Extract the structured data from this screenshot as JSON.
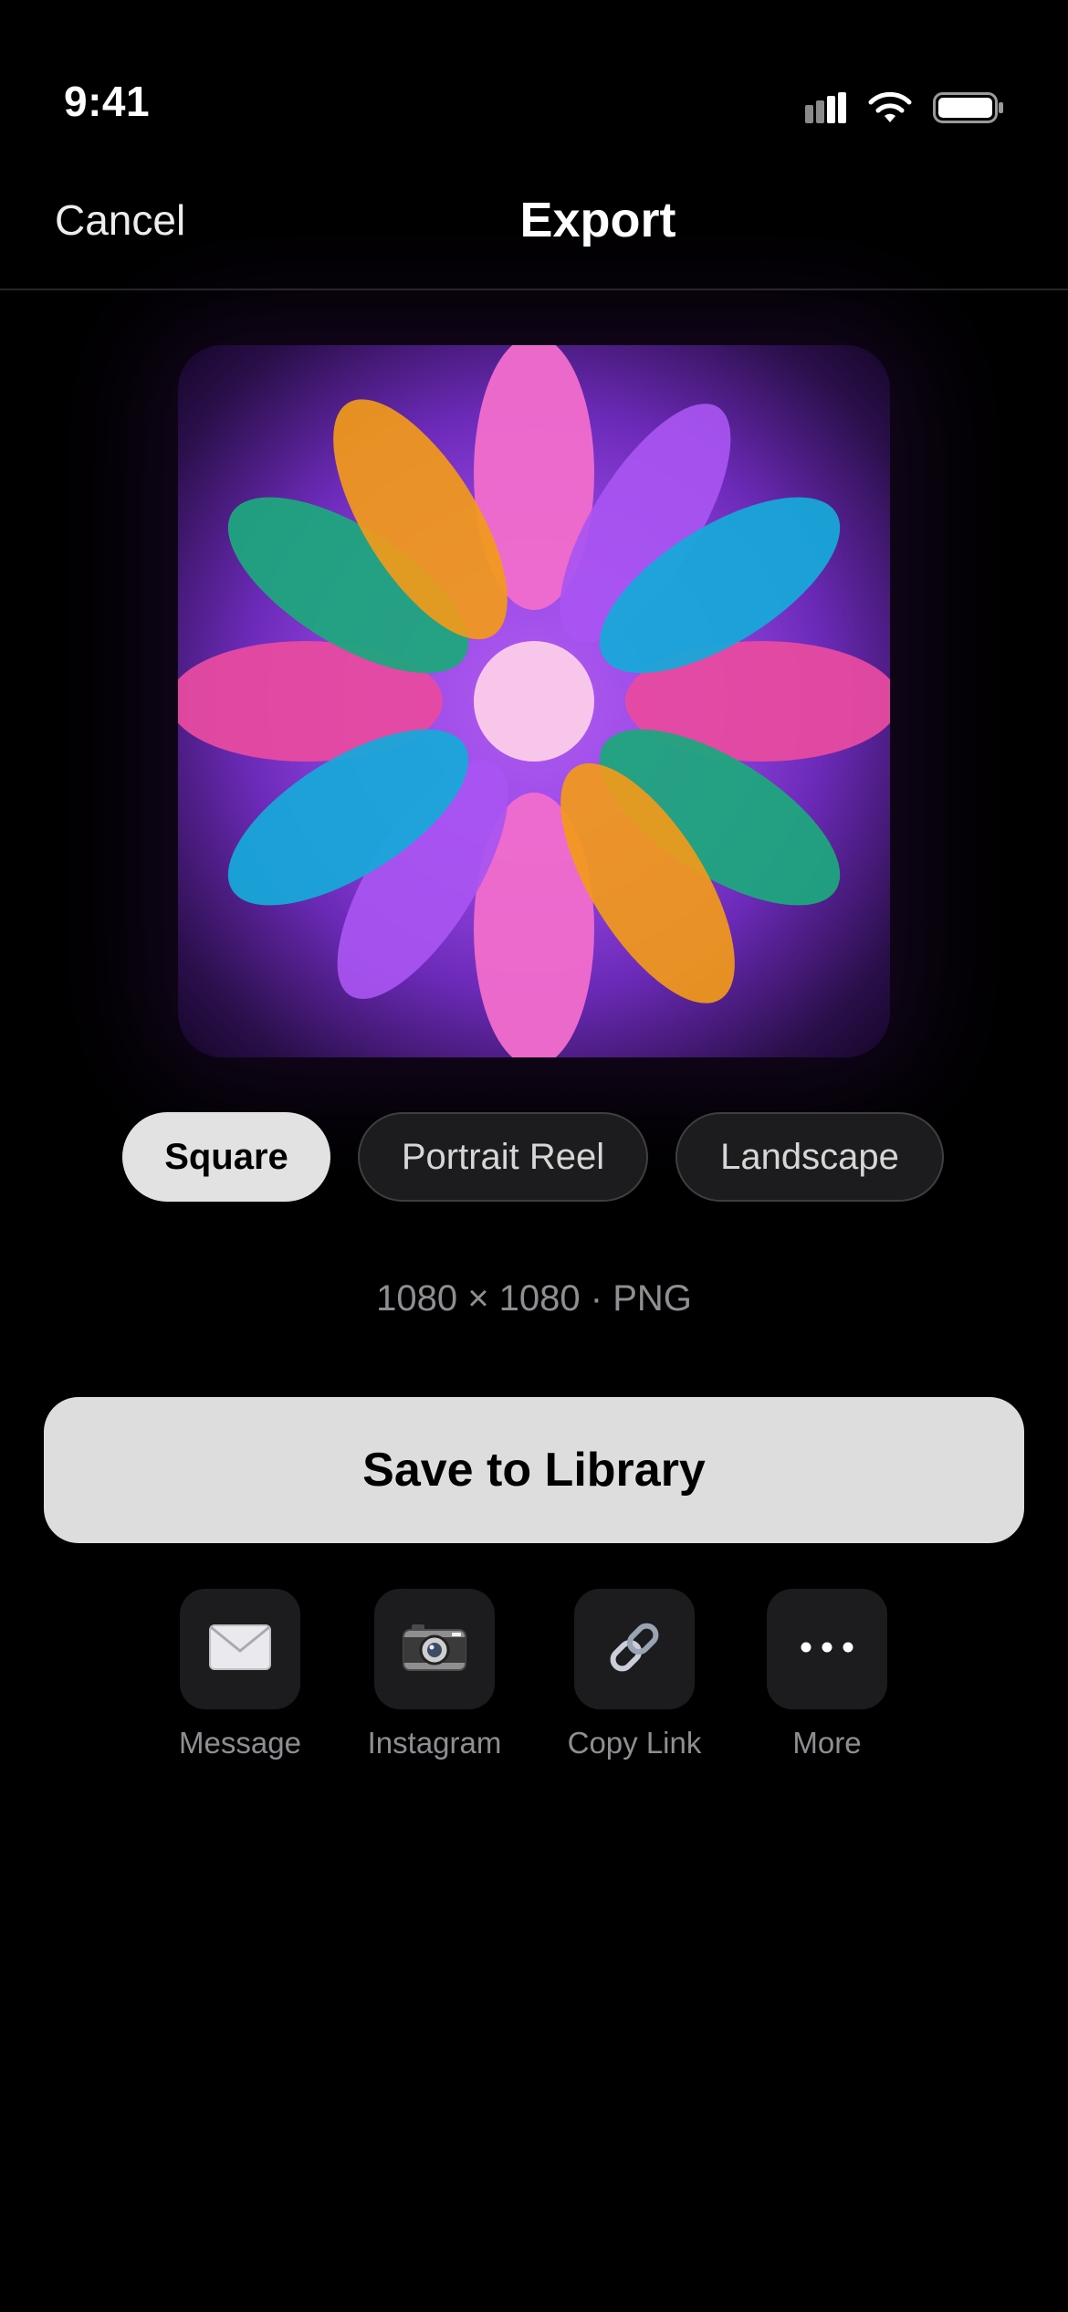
{
  "status_bar": {
    "time": "9:41",
    "icons": [
      "cellular-signal-icon",
      "wifi-icon",
      "battery-icon"
    ]
  },
  "nav": {
    "cancel_label": "Cancel",
    "title": "Export"
  },
  "preview": {
    "artwork": "flower-petals-artwork",
    "colors": {
      "background": "#9a48e8",
      "pink": "#f06ccc",
      "violet": "#a955f2",
      "orange": "#f29a1a",
      "green": "#1fa57e",
      "cyan": "#17a8d9",
      "magenta": "#e84aa0",
      "center": "#f8c6ea"
    }
  },
  "formats": [
    {
      "label": "Square",
      "selected": true
    },
    {
      "label": "Portrait Reel",
      "selected": false
    },
    {
      "label": "Landscape",
      "selected": false
    }
  ],
  "meta_info": "1080 × 1080 · PNG",
  "save_button_label": "Save to Library",
  "share_targets": [
    {
      "label": "Message",
      "icon": "envelope-icon"
    },
    {
      "label": "Instagram",
      "icon": "camera-icon"
    },
    {
      "label": "Copy Link",
      "icon": "link-icon"
    },
    {
      "label": "More",
      "icon": "more-icon"
    }
  ],
  "theme": {
    "background": "#000000",
    "accent_button": "#dddddd",
    "secondary_text": "#8e8e93"
  }
}
